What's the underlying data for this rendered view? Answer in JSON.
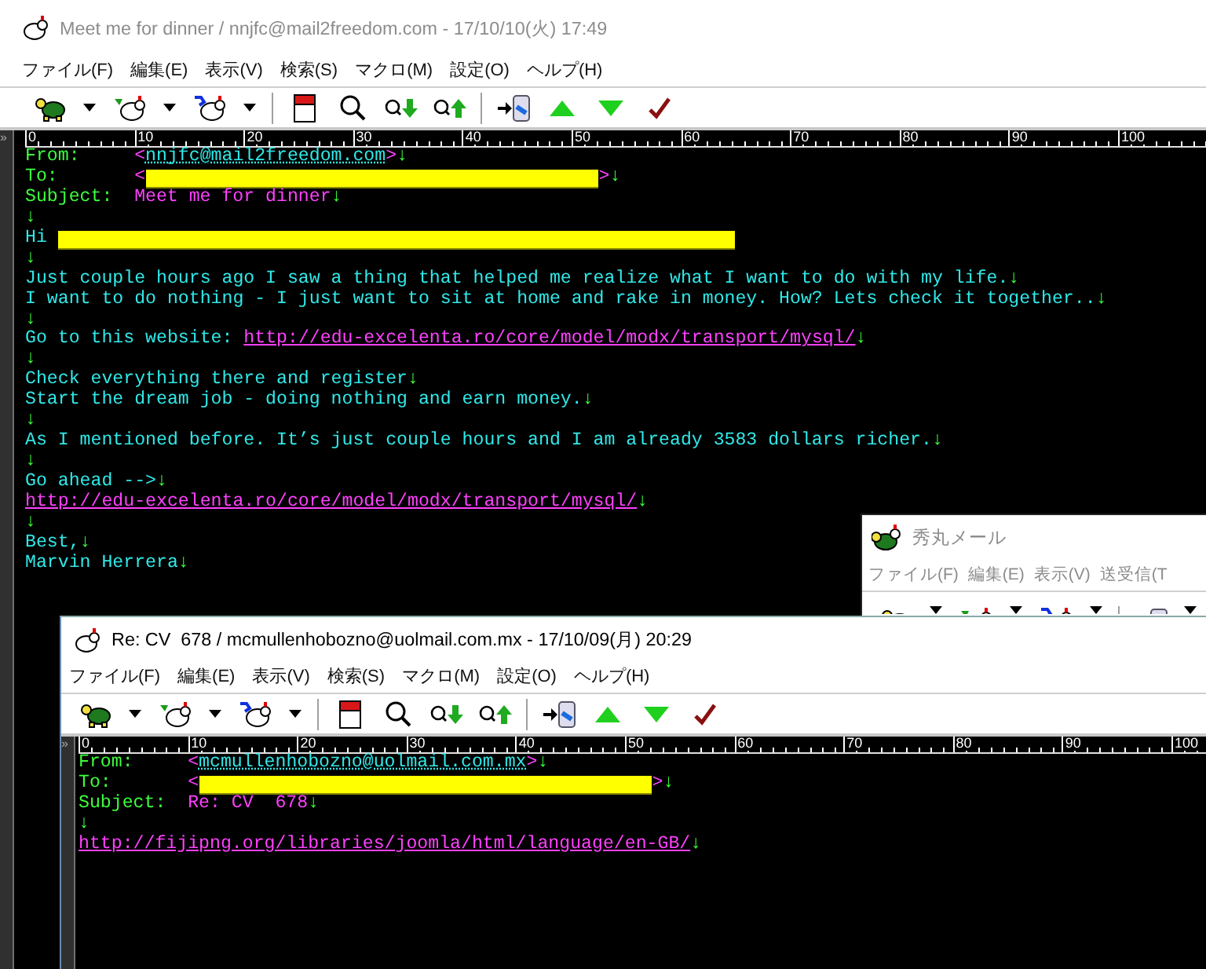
{
  "windows": [
    {
      "kind": "message",
      "active": false,
      "title": "Meet me for dinner / nnjfc@mail2freedom.com - 17/10/10(火) 17:49",
      "menu": [
        "ファイル(F)",
        "編集(E)",
        "表示(V)",
        "検索(S)",
        "マクロ(M)",
        "設定(O)",
        "ヘルプ(H)"
      ],
      "ruler_mark": "»",
      "ruler": [
        "0",
        "10",
        "20",
        "30",
        "40",
        "50",
        "60",
        "70",
        "80",
        "90",
        "100"
      ],
      "lines": [
        {
          "kind": "header",
          "segments": [
            {
              "kind": "label",
              "text": "From:"
            },
            {
              "kind": "bracket",
              "text": "<"
            },
            {
              "kind": "address",
              "text": "nnjfc@mail2freedom.com"
            },
            {
              "kind": "bracket",
              "text": ">"
            },
            {
              "kind": "eol",
              "text": "↓"
            }
          ]
        },
        {
          "kind": "header",
          "segments": [
            {
              "kind": "label",
              "text": "To:"
            },
            {
              "kind": "bracket",
              "text": "<"
            },
            {
              "kind": "redacted"
            },
            {
              "kind": "bracket",
              "text": ">"
            },
            {
              "kind": "eol",
              "text": "↓"
            }
          ]
        },
        {
          "kind": "header",
          "segments": [
            {
              "kind": "label",
              "text": "Subject:"
            },
            {
              "kind": "subject",
              "text": "Meet me for dinner"
            },
            {
              "kind": "eol",
              "text": "↓"
            }
          ]
        },
        {
          "kind": "body",
          "segments": [
            {
              "kind": "eol",
              "text": "↓"
            }
          ]
        },
        {
          "kind": "body",
          "segments": [
            {
              "kind": "text",
              "text": "Hi"
            },
            {
              "kind": "redacted"
            }
          ]
        },
        {
          "kind": "body",
          "segments": [
            {
              "kind": "eol",
              "text": "↓"
            }
          ]
        },
        {
          "kind": "body",
          "segments": [
            {
              "kind": "text",
              "text": "Just couple hours ago I saw a thing that helped me realize what I want to do with my life."
            },
            {
              "kind": "eol",
              "text": "↓"
            }
          ]
        },
        {
          "kind": "body",
          "segments": [
            {
              "kind": "text",
              "text": "I want to do nothing - I just want to sit at home and rake in money. How? Lets check it together.."
            },
            {
              "kind": "eol",
              "text": "↓"
            }
          ]
        },
        {
          "kind": "body",
          "segments": [
            {
              "kind": "eol",
              "text": "↓"
            }
          ]
        },
        {
          "kind": "body",
          "segments": [
            {
              "kind": "text",
              "text": "Go to this website: "
            },
            {
              "kind": "link",
              "text": "http://edu-excelenta.ro/core/model/modx/transport/mysql/"
            },
            {
              "kind": "eol",
              "text": "↓"
            }
          ]
        },
        {
          "kind": "body",
          "segments": [
            {
              "kind": "eol",
              "text": "↓"
            }
          ]
        },
        {
          "kind": "body",
          "segments": [
            {
              "kind": "text",
              "text": "Check everything there and register"
            },
            {
              "kind": "eol",
              "text": "↓"
            }
          ]
        },
        {
          "kind": "body",
          "segments": [
            {
              "kind": "text",
              "text": "Start the dream job - doing nothing and earn money."
            },
            {
              "kind": "eol",
              "text": "↓"
            }
          ]
        },
        {
          "kind": "body",
          "segments": [
            {
              "kind": "eol",
              "text": "↓"
            }
          ]
        },
        {
          "kind": "body",
          "segments": [
            {
              "kind": "text",
              "text": "As I mentioned before. It’s just couple hours and I am already 3583 dollars richer."
            },
            {
              "kind": "eol",
              "text": "↓"
            }
          ]
        },
        {
          "kind": "body",
          "segments": [
            {
              "kind": "eol",
              "text": "↓"
            }
          ]
        },
        {
          "kind": "body",
          "segments": [
            {
              "kind": "text",
              "text": "Go ahead -->"
            },
            {
              "kind": "eol",
              "text": "↓"
            }
          ]
        },
        {
          "kind": "body",
          "segments": [
            {
              "kind": "link",
              "text": "http://edu-excelenta.ro/core/model/modx/transport/mysql/"
            },
            {
              "kind": "eol",
              "text": "↓"
            }
          ]
        },
        {
          "kind": "body",
          "segments": [
            {
              "kind": "eol",
              "text": "↓"
            }
          ]
        },
        {
          "kind": "body",
          "segments": [
            {
              "kind": "text",
              "text": "Best,"
            },
            {
              "kind": "eol",
              "text": "↓"
            }
          ]
        },
        {
          "kind": "body",
          "segments": [
            {
              "kind": "text",
              "text": "Marvin Herrera"
            },
            {
              "kind": "eol",
              "text": "↓"
            }
          ]
        }
      ]
    },
    {
      "kind": "main",
      "active": false,
      "title": "秀丸メール",
      "menu": [
        "ファイル(F)",
        "編集(E)",
        "表示(V)",
        "送受信(T"
      ]
    },
    {
      "kind": "message",
      "active": true,
      "title": "Re: CV  678 / mcmullenhobozno@uolmail.com.mx - 17/10/09(月) 20:29",
      "menu": [
        "ファイル(F)",
        "編集(E)",
        "表示(V)",
        "検索(S)",
        "マクロ(M)",
        "設定(O)",
        "ヘルプ(H)"
      ],
      "ruler_mark": "»",
      "ruler": [
        "0",
        "10",
        "20",
        "30",
        "40",
        "50",
        "60",
        "70",
        "80",
        "90",
        "100"
      ],
      "lines": [
        {
          "kind": "header",
          "segments": [
            {
              "kind": "label",
              "text": "From:"
            },
            {
              "kind": "bracket",
              "text": "<"
            },
            {
              "kind": "address",
              "text": "mcmullenhobozno@uolmail.com.mx"
            },
            {
              "kind": "bracket",
              "text": ">"
            },
            {
              "kind": "eol",
              "text": "↓"
            }
          ]
        },
        {
          "kind": "header",
          "segments": [
            {
              "kind": "label",
              "text": "To:"
            },
            {
              "kind": "bracket",
              "text": "<"
            },
            {
              "kind": "redacted"
            },
            {
              "kind": "bracket",
              "text": ">"
            },
            {
              "kind": "eol",
              "text": "↓"
            }
          ]
        },
        {
          "kind": "header",
          "segments": [
            {
              "kind": "label",
              "text": "Subject:"
            },
            {
              "kind": "subject",
              "text": "Re: CV  678"
            },
            {
              "kind": "eol",
              "text": "↓"
            }
          ]
        },
        {
          "kind": "body",
          "segments": [
            {
              "kind": "eol",
              "text": "↓"
            }
          ]
        },
        {
          "kind": "body",
          "segments": [
            {
              "kind": "link",
              "text": "http://fijipng.org/libraries/joomla/html/language/en-GB/"
            },
            {
              "kind": "eol",
              "text": "↓"
            }
          ]
        }
      ]
    }
  ]
}
